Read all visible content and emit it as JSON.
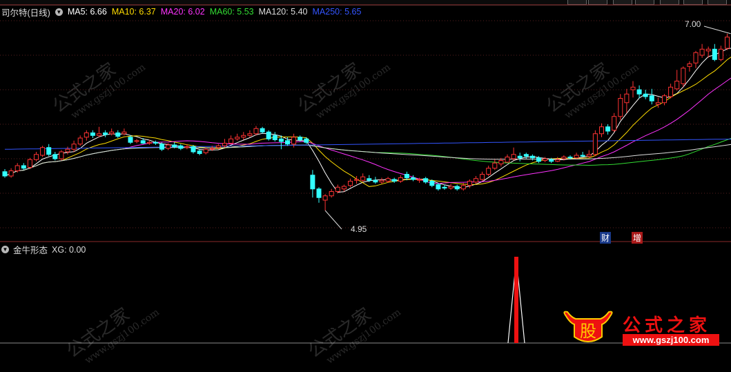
{
  "legend": {
    "stock_name": "司尔特(日线)",
    "ma": [
      {
        "label": "MA5: 6.66",
        "color": "#ffffff"
      },
      {
        "label": "MA10: 6.37",
        "color": "#ffdd00"
      },
      {
        "label": "MA20: 6.02",
        "color": "#ff33ff"
      },
      {
        "label": "MA60: 5.53",
        "color": "#33dd33"
      },
      {
        "label": "MA120: 5.40",
        "color": "#dddddd"
      },
      {
        "label": "MA250: 5.65",
        "color": "#3355ff"
      }
    ]
  },
  "price_labels": {
    "high": "7.00",
    "low": "4.95"
  },
  "event_badges": {
    "cai": "财",
    "zeng": "增"
  },
  "indicator": {
    "name": "金牛形态",
    "value_label": "XG: 0.00"
  },
  "watermark": {
    "text": "公式之家",
    "url": "www.gszj100.com"
  },
  "logo": {
    "text": "公式之家",
    "url": "www.gszj100.com"
  },
  "colors": {
    "up": "#ff3333",
    "down": "#33ffff",
    "background": "#000000",
    "grid": "#5a2020"
  },
  "chart_data": {
    "type": "candlestick",
    "title": "司尔特(日线)",
    "ylim": [
      4.75,
      7.15
    ],
    "annotations": [
      {
        "label": "7.00",
        "value": 7.0
      },
      {
        "label": "4.95",
        "value": 4.95
      }
    ],
    "candles": [
      [
        5.4,
        5.35,
        5.43,
        5.33
      ],
      [
        5.35,
        5.41,
        5.44,
        5.33
      ],
      [
        5.41,
        5.47,
        5.5,
        5.39
      ],
      [
        5.47,
        5.44,
        5.5,
        5.42
      ],
      [
        5.45,
        5.54,
        5.56,
        5.43
      ],
      [
        5.54,
        5.6,
        5.63,
        5.52
      ],
      [
        5.59,
        5.68,
        5.7,
        5.57
      ],
      [
        5.68,
        5.6,
        5.72,
        5.58
      ],
      [
        5.6,
        5.55,
        5.63,
        5.53
      ],
      [
        5.55,
        5.63,
        5.65,
        5.53
      ],
      [
        5.63,
        5.66,
        5.69,
        5.6
      ],
      [
        5.66,
        5.72,
        5.76,
        5.63
      ],
      [
        5.72,
        5.79,
        5.82,
        5.7
      ],
      [
        5.8,
        5.85,
        5.88,
        5.76
      ],
      [
        5.85,
        5.82,
        5.88,
        5.79
      ],
      [
        5.82,
        5.84,
        5.92,
        5.8
      ],
      [
        5.85,
        5.83,
        5.88,
        5.8
      ],
      [
        5.84,
        5.86,
        5.9,
        5.82
      ],
      [
        5.85,
        5.81,
        5.88,
        5.79
      ],
      [
        5.84,
        5.86,
        5.9,
        5.82
      ],
      [
        5.8,
        5.74,
        5.82,
        5.72
      ],
      [
        5.75,
        5.76,
        5.78,
        5.73
      ],
      [
        5.76,
        5.73,
        5.79,
        5.72
      ],
      [
        5.73,
        5.74,
        5.77,
        5.71
      ],
      [
        5.74,
        5.73,
        5.76,
        5.71
      ],
      [
        5.72,
        5.66,
        5.74,
        5.64
      ],
      [
        5.67,
        5.71,
        5.73,
        5.65
      ],
      [
        5.71,
        5.69,
        5.74,
        5.67
      ],
      [
        5.7,
        5.67,
        5.72,
        5.65
      ],
      [
        5.68,
        5.69,
        5.72,
        5.66
      ],
      [
        5.69,
        5.63,
        5.71,
        5.61
      ],
      [
        5.64,
        5.61,
        5.66,
        5.59
      ],
      [
        5.62,
        5.66,
        5.68,
        5.6
      ],
      [
        5.66,
        5.67,
        5.7,
        5.64
      ],
      [
        5.68,
        5.7,
        5.72,
        5.66
      ],
      [
        5.7,
        5.73,
        5.78,
        5.68
      ],
      [
        5.73,
        5.78,
        5.82,
        5.72
      ],
      [
        5.78,
        5.8,
        5.84,
        5.76
      ],
      [
        5.8,
        5.82,
        5.86,
        5.77
      ],
      [
        5.82,
        5.84,
        5.88,
        5.8
      ],
      [
        5.84,
        5.9,
        5.93,
        5.82
      ],
      [
        5.9,
        5.86,
        5.92,
        5.84
      ],
      [
        5.86,
        5.78,
        5.88,
        5.76
      ],
      [
        5.82,
        5.77,
        5.86,
        5.75
      ],
      [
        5.78,
        5.75,
        5.82,
        5.66
      ],
      [
        5.76,
        5.72,
        5.8,
        5.7
      ],
      [
        5.72,
        5.8,
        5.84,
        5.68
      ],
      [
        5.8,
        5.77,
        5.82,
        5.75
      ],
      [
        5.78,
        5.74,
        5.8,
        5.72
      ],
      [
        5.36,
        5.2,
        5.42,
        5.1
      ],
      [
        5.2,
        5.1,
        5.22,
        5.04
      ],
      [
        5.07,
        5.12,
        5.14,
        4.95
      ],
      [
        5.12,
        5.17,
        5.2,
        5.1
      ],
      [
        5.17,
        5.22,
        5.25,
        5.15
      ],
      [
        5.2,
        5.23,
        5.25,
        5.17
      ],
      [
        5.24,
        5.29,
        5.32,
        5.22
      ],
      [
        5.3,
        5.31,
        5.35,
        5.26
      ],
      [
        5.3,
        5.34,
        5.38,
        5.28
      ],
      [
        5.32,
        5.3,
        5.36,
        5.28
      ],
      [
        5.3,
        5.28,
        5.34,
        5.26
      ],
      [
        5.28,
        5.3,
        5.33,
        5.26
      ],
      [
        5.29,
        5.32,
        5.34,
        5.27
      ],
      [
        5.31,
        5.29,
        5.33,
        5.27
      ],
      [
        5.29,
        5.33,
        5.36,
        5.27
      ],
      [
        5.37,
        5.33,
        5.4,
        5.3
      ],
      [
        5.33,
        5.31,
        5.36,
        5.29
      ],
      [
        5.3,
        5.31,
        5.33,
        5.27
      ],
      [
        5.32,
        5.28,
        5.34,
        5.26
      ],
      [
        5.29,
        5.24,
        5.31,
        5.22
      ],
      [
        5.25,
        5.2,
        5.27,
        5.18
      ],
      [
        5.22,
        5.21,
        5.25,
        5.19
      ],
      [
        5.21,
        5.23,
        5.26,
        5.19
      ],
      [
        5.23,
        5.2,
        5.25,
        5.18
      ],
      [
        5.2,
        5.24,
        5.27,
        5.18
      ],
      [
        5.24,
        5.29,
        5.31,
        5.21
      ],
      [
        5.28,
        5.32,
        5.35,
        5.26
      ],
      [
        5.31,
        5.37,
        5.4,
        5.29
      ],
      [
        5.37,
        5.44,
        5.47,
        5.35
      ],
      [
        5.44,
        5.5,
        5.54,
        5.42
      ],
      [
        5.49,
        5.53,
        5.56,
        5.46
      ],
      [
        5.51,
        5.57,
        5.6,
        5.5
      ],
      [
        5.55,
        5.6,
        5.68,
        5.53
      ],
      [
        5.58,
        5.56,
        5.62,
        5.52
      ],
      [
        5.6,
        5.58,
        5.62,
        5.55
      ],
      [
        5.58,
        5.56,
        5.6,
        5.53
      ],
      [
        5.56,
        5.52,
        5.58,
        5.5
      ],
      [
        5.53,
        5.55,
        5.57,
        5.51
      ],
      [
        5.54,
        5.52,
        5.56,
        5.5
      ],
      [
        5.52,
        5.54,
        5.57,
        5.51
      ],
      [
        5.55,
        5.57,
        5.59,
        5.53
      ],
      [
        5.57,
        5.56,
        5.59,
        5.54
      ],
      [
        5.56,
        5.59,
        5.62,
        5.55
      ],
      [
        5.59,
        5.58,
        5.63,
        5.57
      ],
      [
        5.58,
        5.6,
        5.65,
        5.56
      ],
      [
        5.6,
        5.84,
        5.88,
        5.58
      ],
      [
        5.84,
        5.92,
        5.96,
        5.8
      ],
      [
        5.92,
        5.87,
        5.95,
        5.83
      ],
      [
        5.88,
        6.04,
        6.08,
        5.86
      ],
      [
        6.04,
        6.25,
        6.3,
        6.0
      ],
      [
        6.2,
        6.3,
        6.36,
        6.08
      ],
      [
        6.35,
        6.38,
        6.45,
        6.26
      ],
      [
        6.35,
        6.3,
        6.4,
        6.25
      ],
      [
        6.3,
        6.27,
        6.35,
        6.24
      ],
      [
        6.28,
        6.22,
        6.36,
        6.18
      ],
      [
        6.18,
        6.2,
        6.26,
        6.14
      ],
      [
        6.2,
        6.28,
        6.3,
        6.17
      ],
      [
        6.27,
        6.38,
        6.42,
        6.25
      ],
      [
        6.36,
        6.45,
        6.58,
        6.34
      ],
      [
        6.42,
        6.6,
        6.62,
        6.38
      ],
      [
        6.62,
        6.65,
        6.68,
        6.56
      ],
      [
        6.66,
        6.78,
        6.8,
        6.6
      ],
      [
        6.75,
        6.82,
        6.88,
        6.72
      ],
      [
        6.8,
        6.82,
        6.85,
        6.72
      ],
      [
        6.82,
        6.7,
        6.88,
        6.68
      ],
      [
        6.7,
        6.82,
        6.86,
        6.68
      ],
      [
        6.83,
        6.96,
        7.0,
        6.81
      ],
      [
        6.96,
        6.88,
        7.0,
        6.84
      ]
    ],
    "indicator_series": {
      "name": "XG",
      "signal_bar_index": 103,
      "last_value": 0.0
    }
  }
}
